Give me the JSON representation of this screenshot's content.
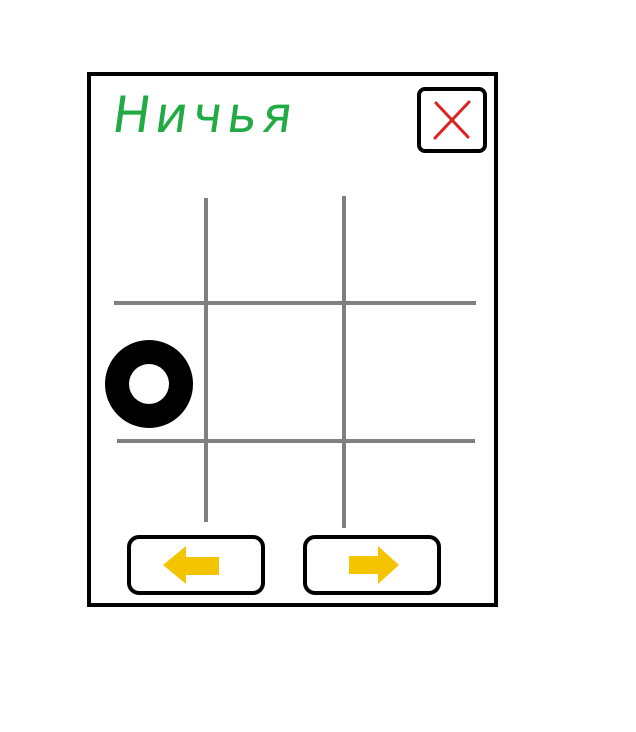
{
  "game": {
    "status_text": "Ничья",
    "status_color": "#22aa44",
    "close_icon": "close-x-icon",
    "close_color": "#dd2222",
    "grid_color": "#808080",
    "board": [
      [
        "",
        "",
        ""
      ],
      [
        "O",
        "",
        ""
      ],
      [
        "",
        "",
        ""
      ]
    ]
  },
  "navigation": {
    "prev_icon": "arrow-left-icon",
    "next_icon": "arrow-right-icon",
    "arrow_color": "#f5c400"
  }
}
